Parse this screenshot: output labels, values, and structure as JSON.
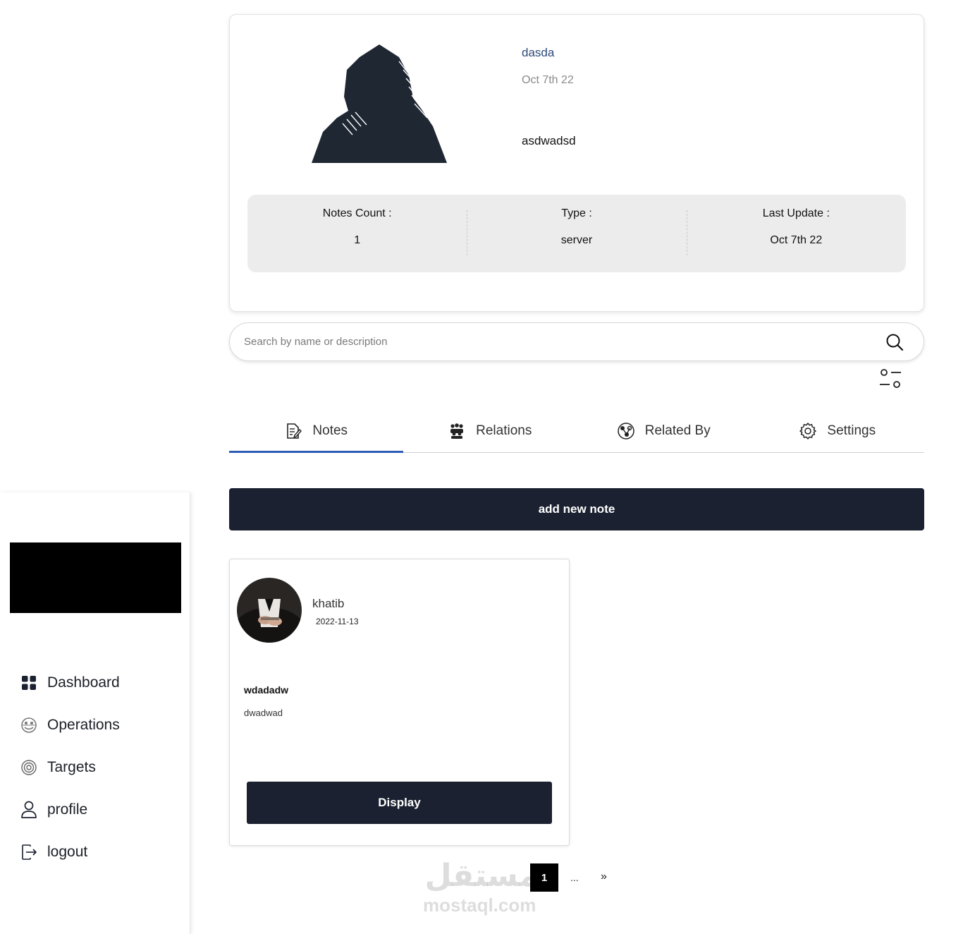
{
  "profile": {
    "name": "dasda",
    "date": "Oct 7th 22",
    "description": "asdwadsd",
    "stats": [
      {
        "label": "Notes Count :",
        "value": "1"
      },
      {
        "label": "Type :",
        "value": "server"
      },
      {
        "label": "Last Update :",
        "value": "Oct 7th 22"
      }
    ]
  },
  "search": {
    "placeholder": "Search by name or description",
    "icon": "search-icon",
    "filter_icon": "filter-sliders-icon"
  },
  "tabs": [
    {
      "label": "Notes",
      "icon": "note-edit-icon",
      "active": true
    },
    {
      "label": "Relations",
      "icon": "group-icon",
      "active": false
    },
    {
      "label": "Related By",
      "icon": "link-network-icon",
      "active": false
    },
    {
      "label": "Settings",
      "icon": "gear-icon",
      "active": false
    }
  ],
  "add_note_label": "add new note",
  "notes": [
    {
      "author": "khatib",
      "date": "2022-11-13",
      "title": "wdadadw",
      "body": "dwadwad",
      "button": "Display"
    }
  ],
  "pagination": {
    "current": "1",
    "ellipsis": "...",
    "next": "»"
  },
  "sidebar": {
    "items": [
      {
        "label": "Dashboard",
        "icon": "dashboard-grid-icon"
      },
      {
        "label": "Operations",
        "icon": "operations-icon"
      },
      {
        "label": "Targets",
        "icon": "target-icon"
      },
      {
        "label": "profile",
        "icon": "user-icon"
      },
      {
        "label": "logout",
        "icon": "logout-icon"
      }
    ]
  },
  "watermark": {
    "arabic": "مستقل",
    "latin": "mostaql.com"
  },
  "colors": {
    "primary_dark": "#1b2130",
    "tab_active": "#2d5bb5",
    "profile_name": "#2c4a78"
  }
}
